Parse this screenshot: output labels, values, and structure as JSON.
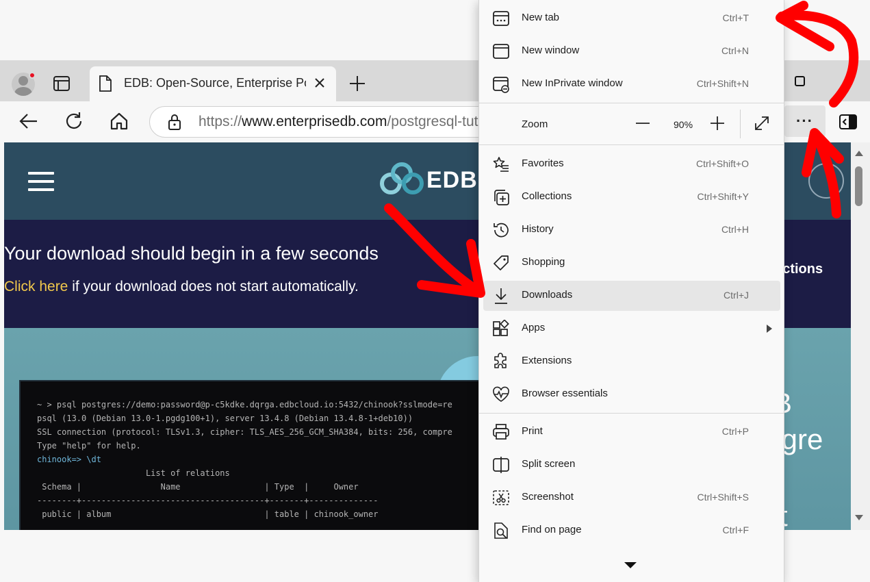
{
  "browser": {
    "tab_title": "EDB: Open-Source, Enterprise Postgres Database",
    "url_prefix": "https://",
    "url_domain": "www.enterprisedb.com",
    "url_path": "/postgresql-tutorial",
    "more_button": "···"
  },
  "page": {
    "logo_text": "EDB",
    "banner_title": "Your download should begin in a few seconds",
    "banner_link": "Click here",
    "banner_rest": " if your download does not start automatically.",
    "banner_side": "uctions",
    "terminal_lines": [
      "~ > psql postgres://demo:password@p-c5kdke.dqrga.edbcloud.io:5432/chinook?sslmode=re",
      "psql (13.0 (Debian 13.0-1.pgdg100+1), server 13.4.8 (Debian 13.4.8-1+deb10))",
      "SSL connection (protocol: TLSv1.3, cipher: TLS_AES_256_GCM_SHA384, bits: 256, compre",
      "Type \"help\" for help.",
      "",
      "chinook=> \\dt",
      "                      List of relations",
      " Schema |                Name                 | Type  |     Owner",
      "--------+-------------------------------------+-------+--------------",
      " public | album                               | table | chinook_owner"
    ],
    "hero_side_1": "B",
    "hero_side_2": "stgre",
    "hero_side_3": "t"
  },
  "menu": {
    "items": [
      {
        "label": "New tab",
        "key": "Ctrl+T",
        "icon": "new-tab-icon"
      },
      {
        "label": "New window",
        "key": "Ctrl+N",
        "icon": "new-window-icon"
      },
      {
        "label": "New InPrivate window",
        "key": "Ctrl+Shift+N",
        "icon": "inprivate-icon"
      },
      {
        "label": "Favorites",
        "key": "Ctrl+Shift+O",
        "icon": "favorites-icon"
      },
      {
        "label": "Collections",
        "key": "Ctrl+Shift+Y",
        "icon": "collections-icon"
      },
      {
        "label": "History",
        "key": "Ctrl+H",
        "icon": "history-icon"
      },
      {
        "label": "Shopping",
        "key": "",
        "icon": "shopping-tag-icon"
      },
      {
        "label": "Downloads",
        "key": "Ctrl+J",
        "icon": "download-icon"
      },
      {
        "label": "Apps",
        "key": "",
        "icon": "apps-icon"
      },
      {
        "label": "Extensions",
        "key": "",
        "icon": "extensions-icon"
      },
      {
        "label": "Browser essentials",
        "key": "",
        "icon": "heartbeat-icon"
      },
      {
        "label": "Print",
        "key": "Ctrl+P",
        "icon": "print-icon"
      },
      {
        "label": "Split screen",
        "key": "",
        "icon": "split-screen-icon"
      },
      {
        "label": "Screenshot",
        "key": "Ctrl+Shift+S",
        "icon": "screenshot-icon"
      },
      {
        "label": "Find on page",
        "key": "Ctrl+F",
        "icon": "find-icon"
      }
    ],
    "zoom_label": "Zoom",
    "zoom_value": "90%",
    "highlighted_item": "Downloads"
  },
  "colors": {
    "annotation": "#ff0000",
    "site_header": "#2c4c60",
    "banner": "#1c1c45",
    "link": "#f2c94c"
  }
}
